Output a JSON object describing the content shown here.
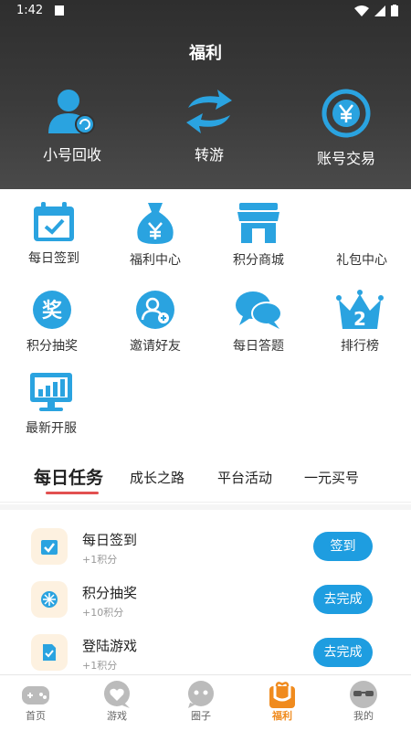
{
  "status_bar": {
    "time": "1:42"
  },
  "header": {
    "title": "福利"
  },
  "top_actions": [
    {
      "label": "小号回收",
      "icon": "user-recycle-icon"
    },
    {
      "label": "转游",
      "icon": "transfer-arrows-icon"
    },
    {
      "label": "账号交易",
      "icon": "yen-exchange-icon"
    }
  ],
  "grid": [
    {
      "label": "每日签到",
      "icon": "calendar-check-icon"
    },
    {
      "label": "福利中心",
      "icon": "money-bag-icon"
    },
    {
      "label": "积分商城",
      "icon": "shop-icon"
    },
    {
      "label": "礼包中心",
      "icon": "gift-icon"
    },
    {
      "label": "积分抽奖",
      "icon": "lottery-icon",
      "glyph": "奖"
    },
    {
      "label": "邀请好友",
      "icon": "invite-friend-icon"
    },
    {
      "label": "每日答题",
      "icon": "chat-bubbles-icon"
    },
    {
      "label": "排行榜",
      "icon": "crown-rank-icon",
      "glyph": "2"
    },
    {
      "label": "最新开服",
      "icon": "monitor-chart-icon"
    }
  ],
  "tabs": [
    "每日任务",
    "成长之路",
    "平台活动",
    "一元买号"
  ],
  "tasks": [
    {
      "name": "每日签到",
      "points": "+1积分",
      "button": "签到"
    },
    {
      "name": "积分抽奖",
      "points": "+10积分",
      "button": "去完成"
    },
    {
      "name": "登陆游戏",
      "points": "+1积分",
      "button": "去完成"
    }
  ],
  "bottom_nav": [
    {
      "label": "首页"
    },
    {
      "label": "游戏"
    },
    {
      "label": "圈子"
    },
    {
      "label": "福利",
      "active": true
    },
    {
      "label": "我的"
    }
  ],
  "colors": {
    "accent_blue": "#1e9de0",
    "accent_orange": "#f08b1e",
    "tab_underline": "#e25050"
  }
}
